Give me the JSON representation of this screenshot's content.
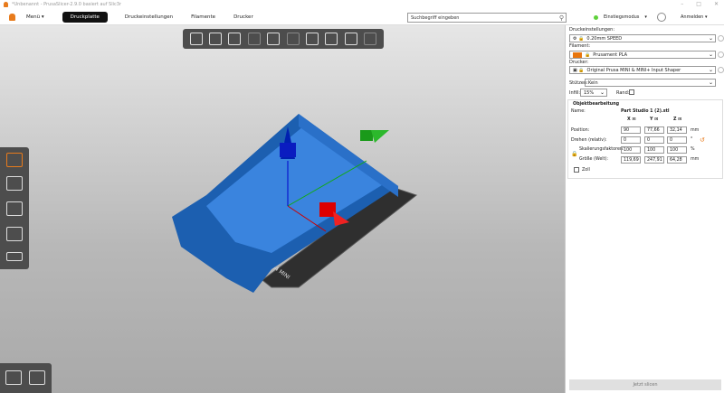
{
  "window": {
    "title": "*Unbenannt - PrusaSlicer-2.9.0 basiert auf Slic3r"
  },
  "menu": {
    "label": "Menü"
  },
  "tabs": [
    {
      "label": "Druckplatte",
      "active": true
    },
    {
      "label": "Druckeinstellungen"
    },
    {
      "label": "Filamente"
    },
    {
      "label": "Drucker"
    }
  ],
  "search": {
    "placeholder": "Suchbegriff eingeben"
  },
  "mode": {
    "label": "Einstiegsmodus",
    "color": "#5fd13b"
  },
  "login": {
    "label": "Anmelden"
  },
  "bed": {
    "label": "S4 MINI"
  },
  "panel": {
    "print_label": "Druckeinstellungen:",
    "print_value": "0.20mm SPEED",
    "filament_label": "Filament:",
    "filament_value": "Prusament PLA",
    "filament_color": "#e8760e",
    "printer_label": "Drucker:",
    "printer_value": "Original Prusa MINI & MINI+ Input Shaper",
    "supports_label": "Stützen:",
    "supports_value": "Kein",
    "infill_label": "Infill:",
    "infill_value": "15%",
    "brim_label": "Rand:",
    "brim_checked": false
  },
  "object": {
    "title": "Objektbearbeitung",
    "name_label": "Name:",
    "name": "Part Studio 1 (2).stl",
    "axes": [
      "X",
      "Y",
      "Z"
    ],
    "position_label": "Position:",
    "position": [
      "90",
      "77,66",
      "32,14"
    ],
    "position_unit": "mm",
    "rotate_label": "Drehen (relativ):",
    "rotate": [
      "0",
      "0",
      "0"
    ],
    "rotate_unit": "°",
    "scale_label": "Skalierungsfaktoren:",
    "scale": [
      "100",
      "100",
      "100"
    ],
    "scale_unit": "%",
    "size_label": "Größe (Welt):",
    "size": [
      "119,69",
      "247,91",
      "64,28"
    ],
    "size_unit": "mm",
    "inch_label": "Zoll",
    "inch_checked": false
  },
  "slice_button": "Jetzt slicen"
}
